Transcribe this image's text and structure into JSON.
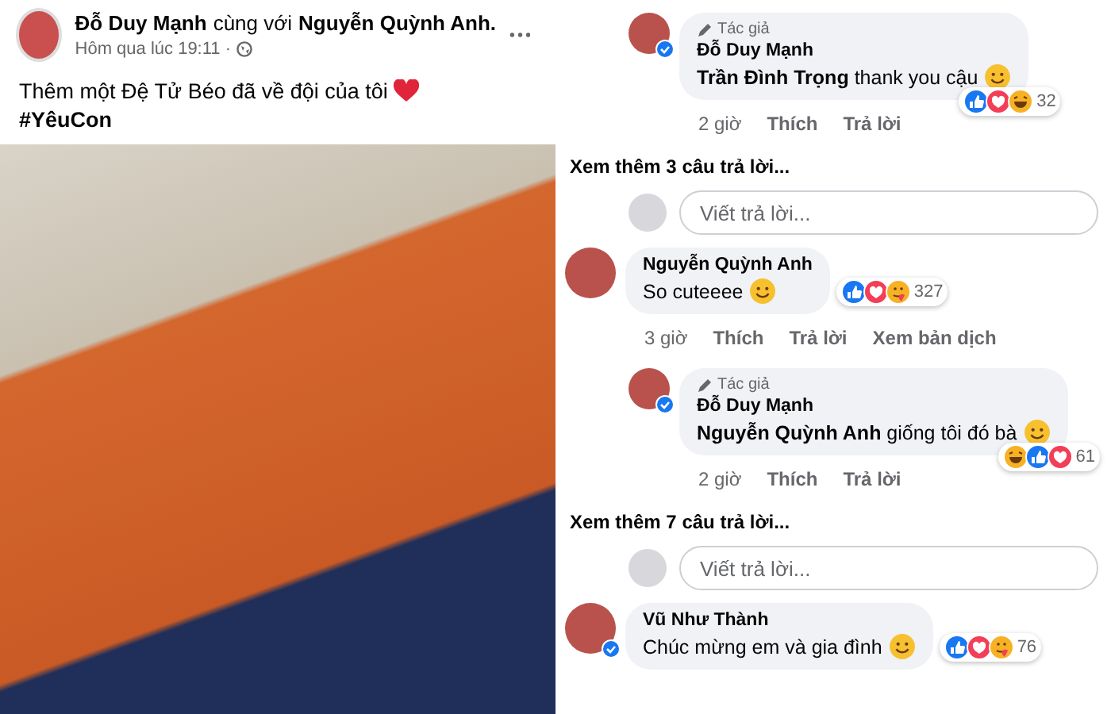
{
  "post": {
    "author": "Đỗ Duy Mạnh",
    "with_text": "cùng với",
    "tagged": "Nguyễn Quỳnh Anh.",
    "time": "Hôm qua lúc 19:11 ·",
    "caption": "Thêm một Đệ Tử Béo đã về đội của tôi",
    "hashtag": "#YêuCon"
  },
  "comments": [
    {
      "kind": "reply",
      "verified": true,
      "badge": "Tác giả",
      "name": "Đỗ Duy Mạnh",
      "text": "**Trần Đình Trọng** thank you cậu",
      "reactions": [
        {
          "kind": "like"
        },
        {
          "kind": "love"
        },
        {
          "kind": "haha"
        }
      ],
      "count": "32",
      "actions": [
        "2 giờ",
        "Thích",
        "Trả lời"
      ]
    },
    {
      "kind": "more",
      "text": "Xem thêm 3 câu trả lời..."
    },
    {
      "kind": "reply_box",
      "placeholder": "Viết trả lời..."
    },
    {
      "kind": "comment",
      "verified": false,
      "name": "Nguyễn Quỳnh Anh",
      "text": "So cuteeee",
      "reactions": [
        {
          "kind": "like"
        },
        {
          "kind": "love"
        },
        {
          "kind": "care"
        }
      ],
      "count": "327",
      "actions": [
        "3 giờ",
        "Thích",
        "Trả lời",
        "Xem bản dịch"
      ]
    },
    {
      "kind": "reply",
      "verified": true,
      "badge": "Tác giả",
      "name": "Đỗ Duy Mạnh",
      "text": "**Nguyễn Quỳnh Anh** giống tôi đó bà",
      "reactions": [
        {
          "kind": "haha"
        },
        {
          "kind": "like"
        },
        {
          "kind": "love"
        }
      ],
      "count": "61",
      "actions": [
        "2 giờ",
        "Thích",
        "Trả lời"
      ]
    },
    {
      "kind": "more",
      "text": "Xem thêm 7 câu trả lời..."
    },
    {
      "kind": "reply_box",
      "placeholder": "Viết trả lời..."
    },
    {
      "kind": "comment",
      "verified": true,
      "name": "Vũ Như Thành",
      "text": "Chúc mừng em và gia đình",
      "reactions": [
        {
          "kind": "like"
        },
        {
          "kind": "love"
        },
        {
          "kind": "care"
        }
      ],
      "count": "76"
    }
  ]
}
